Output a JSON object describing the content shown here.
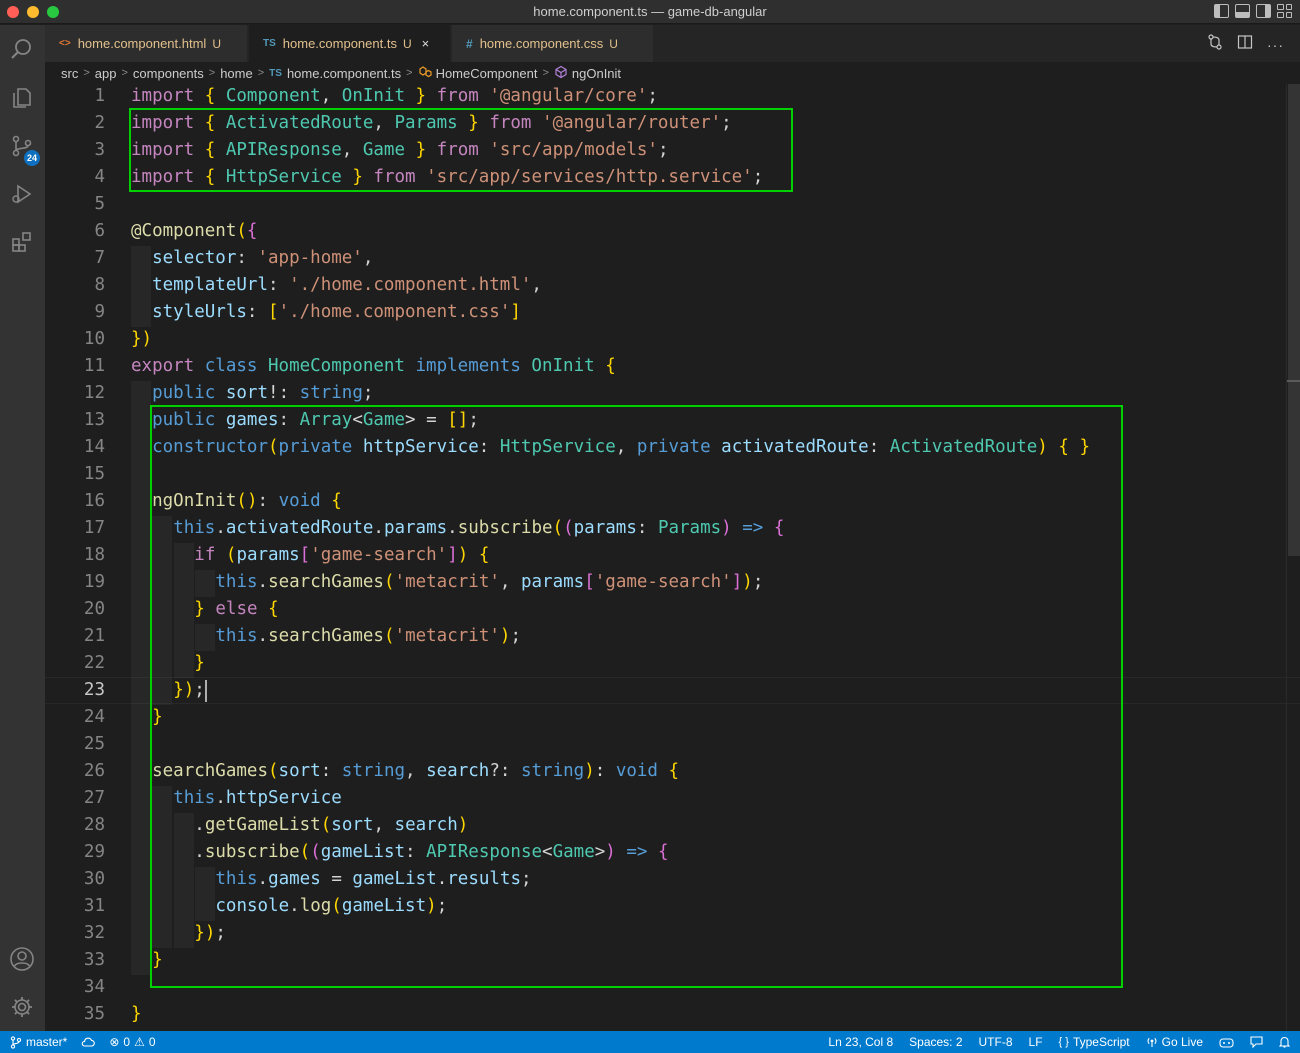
{
  "window": {
    "title": "home.component.ts — game-db-angular"
  },
  "activity_bar": {
    "scm_badge": "24"
  },
  "tabs": [
    {
      "icon": "<>",
      "label": "home.component.html",
      "status": "U",
      "active": false
    },
    {
      "icon": "TS",
      "label": "home.component.ts",
      "status": "U",
      "active": true,
      "close": "×"
    },
    {
      "icon": "#",
      "label": "home.component.css",
      "status": "U",
      "active": false
    }
  ],
  "breadcrumb": {
    "parts": [
      "src",
      "app",
      "components",
      "home"
    ],
    "file_icon": "TS",
    "file": "home.component.ts",
    "symbol_class": "HomeComponent",
    "symbol_method": "ngOnInit",
    "separator": ">"
  },
  "editor": {
    "active_line": 23,
    "line_numbers": [
      "1",
      "2",
      "3",
      "4",
      "5",
      "6",
      "7",
      "8",
      "9",
      "10",
      "11",
      "12",
      "13",
      "14",
      "15",
      "16",
      "17",
      "18",
      "19",
      "20",
      "21",
      "22",
      "23",
      "24",
      "25",
      "26",
      "27",
      "28",
      "29",
      "30",
      "31",
      "32",
      "33",
      "34",
      "35"
    ],
    "code_lines": [
      "import { Component, OnInit } from '@angular/core';",
      "import { ActivatedRoute, Params } from '@angular/router';",
      "import { APIResponse, Game } from 'src/app/models';",
      "import { HttpService } from 'src/app/services/http.service';",
      "",
      "@Component({",
      "  selector: 'app-home',",
      "  templateUrl: './home.component.html',",
      "  styleUrls: ['./home.component.css']",
      "})",
      "export class HomeComponent implements OnInit {",
      "  public sort!: string;",
      "  public games: Array<Game> = [];",
      "  constructor(private httpService: HttpService, private activatedRoute: ActivatedRoute) { }",
      "",
      "  ngOnInit(): void {",
      "    this.activatedRoute.params.subscribe((params: Params) => {",
      "      if (params['game-search']) {",
      "        this.searchGames('metacrit', params['game-search']);",
      "      } else {",
      "        this.searchGames('metacrit');",
      "      }",
      "    });",
      "  }",
      "",
      "  searchGames(sort: string, search?: string): void {",
      "    this.httpService",
      "      .getGameList(sort, search)",
      "      .subscribe((gameList: APIResponse<Game>) => {",
      "        this.games = gameList.results;",
      "        console.log(gameList);",
      "      });",
      "  }",
      "",
      "}"
    ]
  },
  "status_bar": {
    "branch": "master*",
    "errors": "0",
    "warnings": "0",
    "position": "Ln 23, Col 8",
    "spaces": "Spaces: 2",
    "encoding": "UTF-8",
    "eol": "LF",
    "language_icon": "{ }",
    "language": "TypeScript",
    "go_live": "Go Live"
  },
  "colors": {
    "status_bar": "#007acc",
    "highlight_box": "#00d000",
    "editor_bg": "#1e1e1e",
    "modified_file": "#e2c08d"
  }
}
